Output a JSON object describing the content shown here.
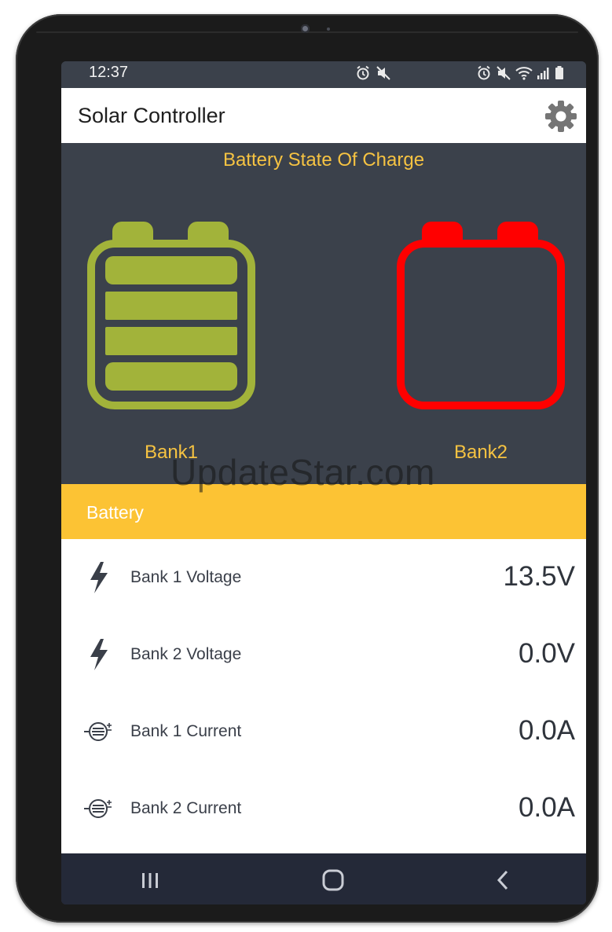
{
  "status_bar": {
    "time": "12:37",
    "left_icons": [
      "alarm-icon",
      "mute-icon"
    ],
    "right_icons": [
      "alarm-icon",
      "mute-icon",
      "wifi-icon",
      "signal-icon",
      "battery-status-icon"
    ]
  },
  "app_bar": {
    "title": "Solar Controller",
    "settings_icon": "gear-icon"
  },
  "state_of_charge": {
    "title": "Battery State Of Charge",
    "banks": [
      {
        "label": "Bank1",
        "level": 4,
        "max_level": 4,
        "color": "#a2b33a"
      },
      {
        "label": "Bank2",
        "level": 0,
        "max_level": 4,
        "color": "#ff0000"
      }
    ]
  },
  "section": {
    "title": "Battery"
  },
  "readings": [
    {
      "label": "Bank 1 Voltage",
      "value": "13.5V",
      "icon": "lightning-bolt-icon"
    },
    {
      "label": "Bank 2 Voltage",
      "value": "0.0V",
      "icon": "lightning-bolt-icon"
    },
    {
      "label": "Bank 1 Current",
      "value": "0.0A",
      "icon": "battery-current-icon"
    },
    {
      "label": "Bank 2 Current",
      "value": "0.0A",
      "icon": "battery-current-icon"
    }
  ],
  "nav_bar": {
    "icons": [
      "recent-apps-icon",
      "home-icon",
      "back-icon"
    ]
  },
  "watermark": "UpdateStar.com",
  "colors": {
    "accent": "#fcc334",
    "label_yellow": "#f6c342",
    "panel": "#3b414b",
    "navbar": "#242938"
  }
}
